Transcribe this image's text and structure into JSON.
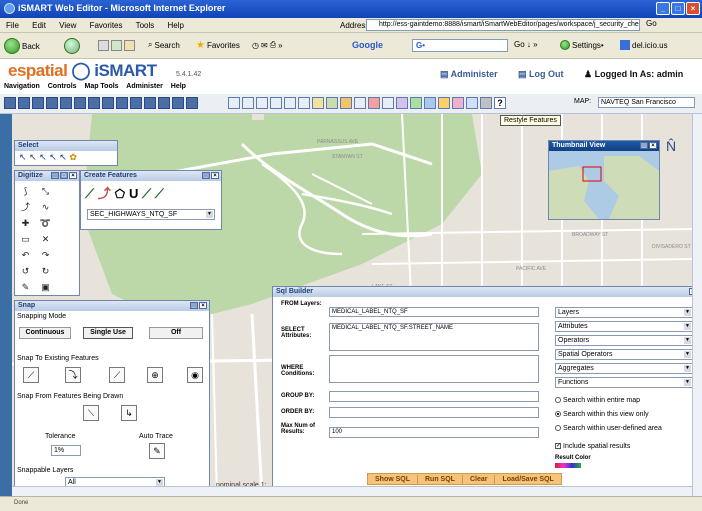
{
  "window": {
    "title": "iSMART Web Editor - Microsoft Internet Explorer"
  },
  "browser": {
    "menu": [
      "File",
      "Edit",
      "View",
      "Favorites",
      "Tools",
      "Help"
    ],
    "address_label": "Address",
    "address": "http://ess-gaintdemo:8888/ismart/iSmartWebEditor/pages/workspace/j_security_check#",
    "go_label": "Go",
    "back_label": "Back",
    "search_label": "Search",
    "favorites_label": "Favorites",
    "google_label": "Google",
    "google_field": "G•",
    "settings_label": "Settings•",
    "delicious_label": "del.icio.us"
  },
  "app": {
    "logo_left": "espatial",
    "logo_right": "iSMART",
    "version": "5.4.1.42",
    "administer": "Administer",
    "logout": "Log Out",
    "logged_in": "Logged In As:  admin",
    "menu": [
      "Navigation",
      "Controls",
      "Map Tools",
      "Administer",
      "Help"
    ],
    "map_label": "MAP:",
    "map_value": "NAVTEQ San Francisco",
    "tooltip": "Restyle Features"
  },
  "panels": {
    "select": {
      "title": "Select"
    },
    "digitize": {
      "title": "Digitize"
    },
    "create": {
      "title": "Create Features",
      "layer": "SEC_HIGHWAYS_NTQ_SF"
    },
    "thumbnail": {
      "title": "Thumbnail View"
    },
    "snap": {
      "title": "Snap",
      "mode_label": "Snapping Mode",
      "continuous": "Continuous",
      "single_use": "Single Use",
      "off": "Off",
      "existing_label": "Snap To Existing Features",
      "drawn_label": "Snap From Features Being Drawn",
      "tolerance_label": "Tolerance",
      "autotrace_label": "Auto Trace",
      "tolerance_value": "1%",
      "layers_label": "Snappable Layers",
      "layers_value": "All"
    },
    "sql": {
      "title": "Sql Builder",
      "from_label": "FROM Layers:",
      "from_value": "MEDICAL_LABEL_NTQ_SF",
      "select_label": "SELECT Attributes:",
      "select_value": "MEDICAL_LABEL_NTQ_SF.STREET_NAME",
      "where_label": "WHERE Conditions:",
      "groupby_label": "GROUP BY:",
      "orderby_label": "ORDER BY:",
      "maxnum_label": "Max Num of Results:",
      "maxnum_value": "100",
      "dropdowns": [
        "Layers",
        "Attributes",
        "Operators",
        "Spatial Operators",
        "Aggregates",
        "Functions"
      ],
      "radios": [
        "Search within entire map",
        "Search within this view only",
        "Search within user-defined area"
      ],
      "include_spatial": "Include spatial results",
      "result_color": "Result Color",
      "buttons": [
        "Show SQL",
        "Run SQL",
        "Clear",
        "Load/Save SQL"
      ]
    }
  },
  "map_labels": [
    "PARNASSUS AVE",
    "STANYAN ST",
    "BROADWAY ST",
    "PACIFIC AVE",
    "DIVISADERO ST",
    "LAKE ST"
  ],
  "scale_label": "nominal scale 1:",
  "status": "Done"
}
